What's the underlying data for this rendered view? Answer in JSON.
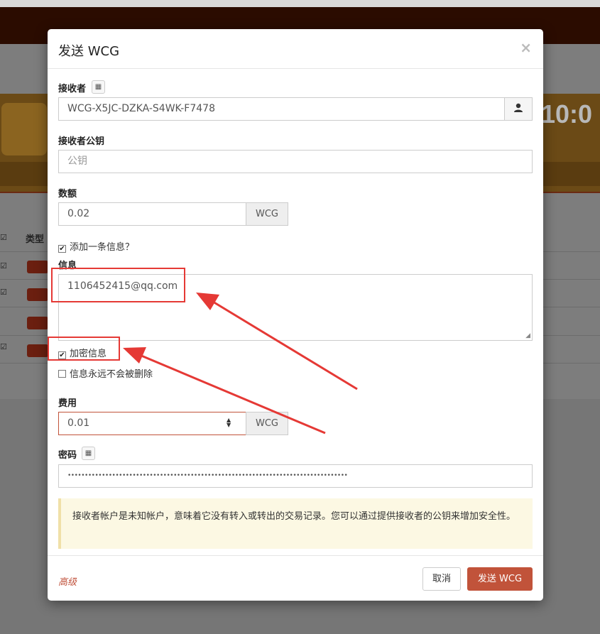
{
  "background": {
    "clock_text": "10:0",
    "table_header_type": "类型"
  },
  "modal": {
    "title": "发送 WCG",
    "close_symbol": "×",
    "recipient": {
      "label": "接收者",
      "value": "WCG-X5JC-DZKA-S4WK-F7478"
    },
    "recipient_public_key": {
      "label": "接收者公钥",
      "placeholder": "公钥"
    },
    "amount": {
      "label": "数额",
      "value": "0.02",
      "unit": "WCG"
    },
    "add_message": {
      "label": "添加一条信息？",
      "checked": true
    },
    "message": {
      "label": "信息",
      "value": "1106452415@qq.com"
    },
    "encrypt_message": {
      "label": "加密信息",
      "checked": true
    },
    "permanent_message": {
      "label": "信息永远不会被删除",
      "checked": false
    },
    "fee": {
      "label": "费用",
      "value": "0.01",
      "unit": "WCG"
    },
    "password": {
      "label": "密码",
      "value": "••••••••••••••••••••••••••••••••••••••••••••••••••••••••••••••••••••••••••••••••••"
    },
    "warning_text": "接收者帐户是未知帐户，意味着它没有转入或转出的交易记录。您可以通过提供接收者的公钥来增加安全性。",
    "footer": {
      "advanced_label": "高级",
      "cancel_label": "取消",
      "send_label": "发送 WCG"
    }
  },
  "colors": {
    "accent": "#c1533a",
    "annotation_red": "#e53935",
    "warning_bg": "#fcf8e3"
  }
}
